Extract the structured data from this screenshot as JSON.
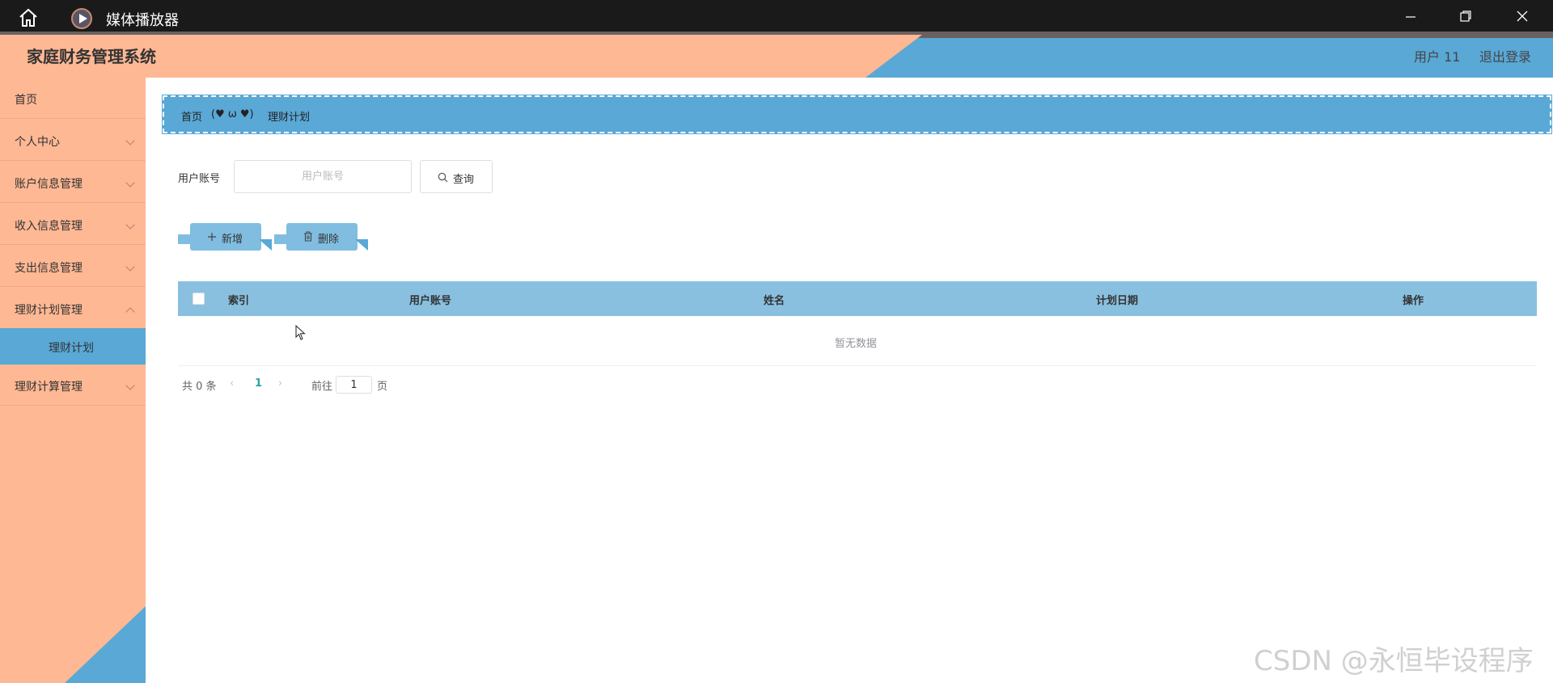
{
  "titlebar": {
    "title": "媒体播放器",
    "icons": [
      "home-icon",
      "media-player-icon",
      "minimize-icon",
      "restore-icon",
      "close-icon"
    ]
  },
  "header": {
    "system_title": "家庭财务管理系统",
    "user_label": "用户 11",
    "logout_label": "退出登录",
    "colors": {
      "peach": "#ffb894",
      "blue": "#59a8d6"
    }
  },
  "sidebar": {
    "items": [
      {
        "label": "首页"
      },
      {
        "label": "个人中心"
      },
      {
        "label": "账户信息管理"
      },
      {
        "label": "收入信息管理"
      },
      {
        "label": "支出信息管理"
      },
      {
        "label": "理财计划管理"
      },
      {
        "label": "理财计算管理"
      }
    ],
    "active_sub": "理财计划"
  },
  "breadcrumb": {
    "home": "首页",
    "separator": "(♥ ω ♥)",
    "current": "理财计划"
  },
  "search": {
    "label": "用户账号",
    "placeholder": "用户账号",
    "button_label": "查询"
  },
  "actions": {
    "add_label": "新增",
    "delete_label": "删除"
  },
  "table": {
    "columns": [
      "索引",
      "用户账号",
      "姓名",
      "计划日期",
      "操作"
    ],
    "empty_text": "暂无数据"
  },
  "pagination": {
    "total_text": "共 0 条",
    "current_page": "1",
    "goto_prefix": "前往",
    "goto_value": "1",
    "goto_suffix": "页"
  },
  "watermark": "CSDN @永恒毕设程序"
}
